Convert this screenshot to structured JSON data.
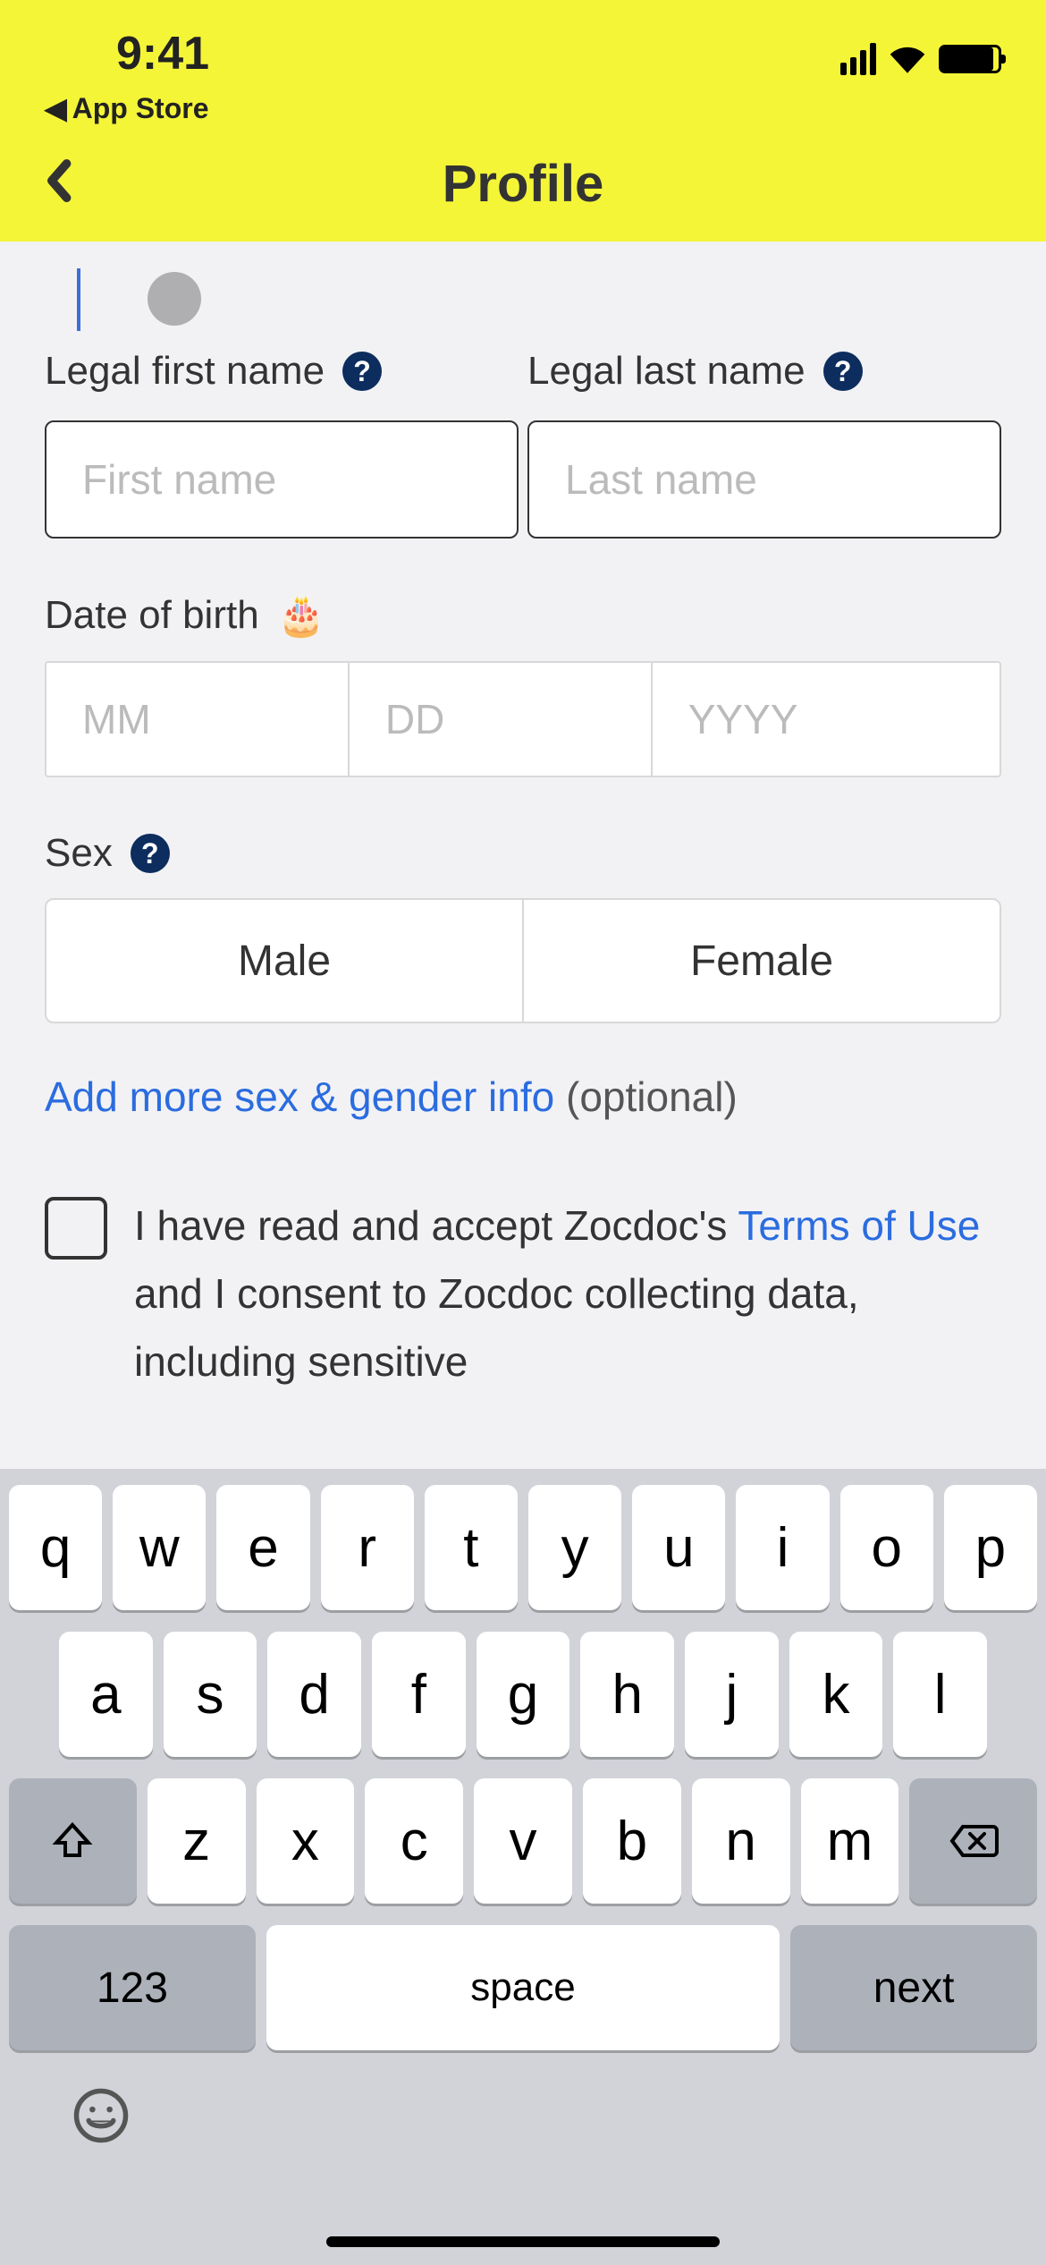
{
  "status": {
    "time": "9:41",
    "back_source": "App Store"
  },
  "header": {
    "title": "Profile"
  },
  "form": {
    "first_name": {
      "label": "Legal first name",
      "placeholder": "First name",
      "value": ""
    },
    "last_name": {
      "label": "Legal last name",
      "placeholder": "Last name",
      "value": ""
    },
    "dob": {
      "label": "Date of birth",
      "emoji": "🎂",
      "month": "MM",
      "day": "DD",
      "year": "YYYY"
    },
    "sex": {
      "label": "Sex",
      "options": [
        "Male",
        "Female"
      ]
    },
    "gender_link": "Add more sex & gender info",
    "gender_optional": "(optional)",
    "terms": {
      "prefix": "I have read and accept Zocdoc's ",
      "terms_link": "Terms of Use",
      "middle": " and I consent to Zocdoc collecting data, including sensitive"
    }
  },
  "keyboard": {
    "row1": [
      "q",
      "w",
      "e",
      "r",
      "t",
      "y",
      "u",
      "i",
      "o",
      "p"
    ],
    "row2": [
      "a",
      "s",
      "d",
      "f",
      "g",
      "h",
      "j",
      "k",
      "l"
    ],
    "row3": [
      "z",
      "x",
      "c",
      "v",
      "b",
      "n",
      "m"
    ],
    "num_key": "123",
    "space_key": "space",
    "next_key": "next"
  }
}
